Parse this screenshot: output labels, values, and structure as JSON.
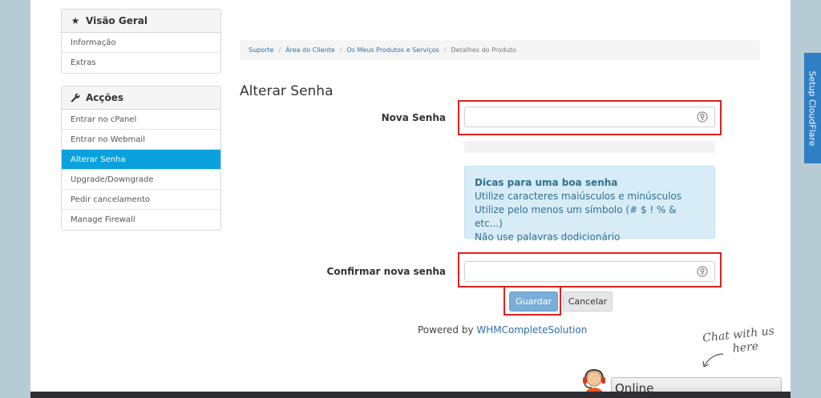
{
  "sidebar": {
    "overview": {
      "title": "Visão Geral",
      "icon": "star-icon",
      "items": [
        "Informação",
        "Extras"
      ]
    },
    "actions": {
      "title": "Acções",
      "icon": "wrench-icon",
      "items": [
        "Entrar no cPanel",
        "Entrar no Webmail",
        "Alterar Senha",
        "Upgrade/Downgrade",
        "Pedir cancelamento",
        "Manage Firewall"
      ],
      "active": "Alterar Senha"
    }
  },
  "breadcrumb": {
    "items": [
      "Suporte",
      "Área do Cliente",
      "Os Meus Produtos e Serviços"
    ],
    "current": "Detalhes do Produto",
    "separator": "/"
  },
  "page": {
    "title": "Alterar Senha"
  },
  "form": {
    "new_password_label": "Nova Senha",
    "new_password_value": "",
    "confirm_password_label": "Confirmar nova senha",
    "confirm_password_value": ""
  },
  "tips": {
    "title": "Dicas para uma boa senha",
    "lines": [
      "Utilize caracteres maiúsculos e minúsculos",
      "Utilize pelo menos um símbolo (# $ ! % & etc...)",
      "Não use palavras dodicionário"
    ]
  },
  "buttons": {
    "save": "Guardar",
    "cancel": "Cancelar"
  },
  "footer": {
    "powered_prefix": "Powered by ",
    "powered_link": "WHMCompleteSolution"
  },
  "cloudflare": {
    "label": "Setup CloudFlare"
  },
  "chat": {
    "note_line1": "Chat with us",
    "note_line2": "here",
    "status": "Online"
  },
  "colors": {
    "accent": "#0aa1de",
    "highlight": "#e02020",
    "tips_bg": "#d7ecf6",
    "cloudflare": "#2f7fc5"
  }
}
